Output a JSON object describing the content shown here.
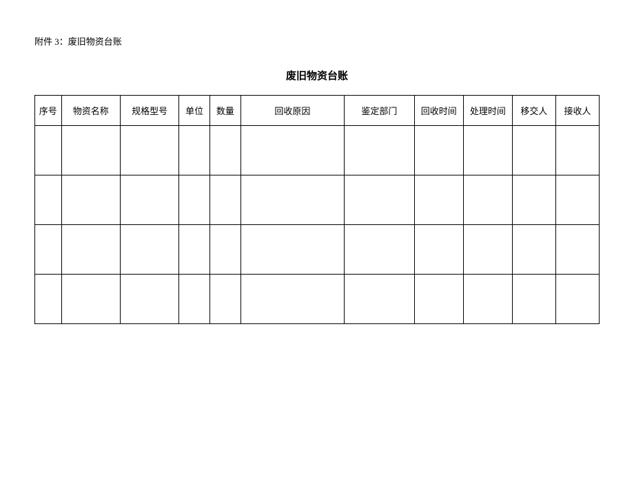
{
  "attachment_label": "附件 3：废旧物资台账",
  "title": "废旧物资台账",
  "headers": {
    "seq": "序号",
    "name": "物资名称",
    "spec": "规格型号",
    "unit": "单位",
    "qty": "数量",
    "reason": "回收原因",
    "dept": "鉴定部门",
    "rtime": "回收时间",
    "ptime": "处理时间",
    "handover": "移交人",
    "receiver": "接收人"
  },
  "rows": [
    {
      "seq": "",
      "name": "",
      "spec": "",
      "unit": "",
      "qty": "",
      "reason": "",
      "dept": "",
      "rtime": "",
      "ptime": "",
      "handover": "",
      "receiver": ""
    },
    {
      "seq": "",
      "name": "",
      "spec": "",
      "unit": "",
      "qty": "",
      "reason": "",
      "dept": "",
      "rtime": "",
      "ptime": "",
      "handover": "",
      "receiver": ""
    },
    {
      "seq": "",
      "name": "",
      "spec": "",
      "unit": "",
      "qty": "",
      "reason": "",
      "dept": "",
      "rtime": "",
      "ptime": "",
      "handover": "",
      "receiver": ""
    },
    {
      "seq": "",
      "name": "",
      "spec": "",
      "unit": "",
      "qty": "",
      "reason": "",
      "dept": "",
      "rtime": "",
      "ptime": "",
      "handover": "",
      "receiver": ""
    }
  ]
}
